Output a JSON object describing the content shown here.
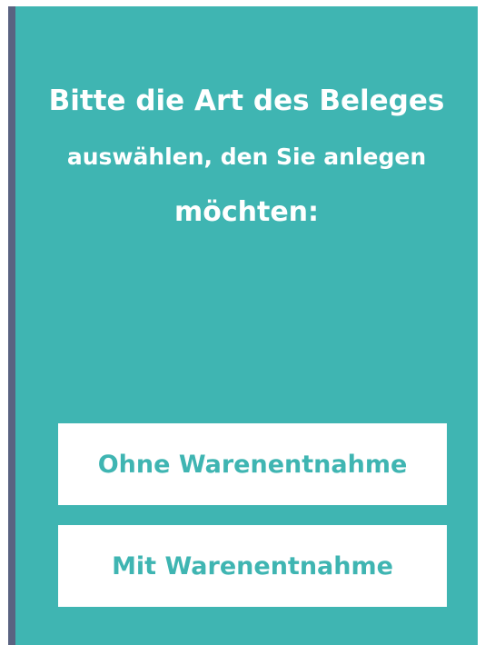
{
  "prompt": {
    "line1": "Bitte die Art des Beleges",
    "line2": "auswählen, den Sie anlegen",
    "line3": "möchten:"
  },
  "options": [
    {
      "label": "Ohne Warenentnahme"
    },
    {
      "label": "Mit Warenentnahme"
    }
  ],
  "colors": {
    "panel": "#3fb5b2",
    "accent_strip": "#5a6381",
    "button_bg": "#ffffff",
    "button_text": "#3fb5b2",
    "prompt_text": "#ffffff"
  }
}
